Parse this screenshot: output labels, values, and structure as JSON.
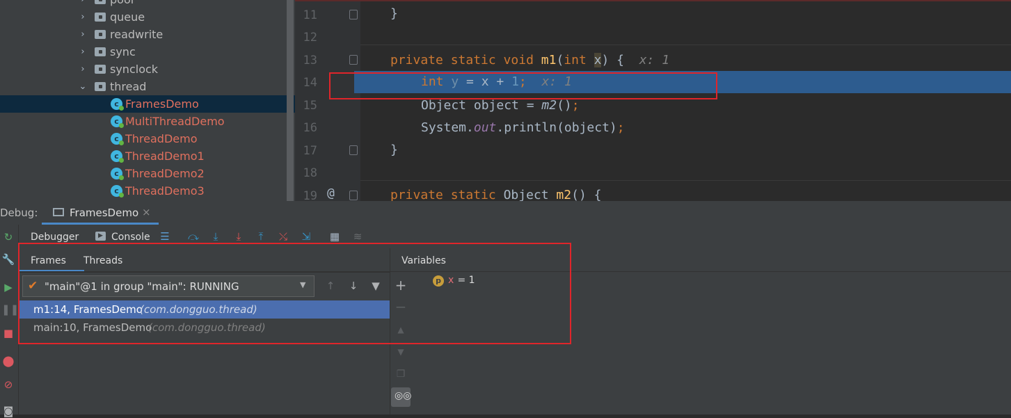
{
  "tree": {
    "items": [
      {
        "label": "pool",
        "type": "folder",
        "expanded": false
      },
      {
        "label": "queue",
        "type": "folder",
        "expanded": false
      },
      {
        "label": "readwrite",
        "type": "folder",
        "expanded": false
      },
      {
        "label": "sync",
        "type": "folder",
        "expanded": false
      },
      {
        "label": "synclock",
        "type": "folder",
        "expanded": false
      },
      {
        "label": "thread",
        "type": "folder",
        "expanded": true
      },
      {
        "label": "FramesDemo",
        "type": "class",
        "selected": true
      },
      {
        "label": "MultiThreadDemo",
        "type": "class"
      },
      {
        "label": "ThreadDemo",
        "type": "class"
      },
      {
        "label": "ThreadDemo1",
        "type": "class"
      },
      {
        "label": "ThreadDemo2",
        "type": "class"
      },
      {
        "label": "ThreadDemo3",
        "type": "class"
      }
    ]
  },
  "editor": {
    "line_numbers": [
      "11",
      "12",
      "13",
      "14",
      "15",
      "16",
      "17",
      "18",
      "19"
    ],
    "line11": "}",
    "line13": {
      "kw": "private static void ",
      "fn": "m1",
      "open": "(",
      "type": "int ",
      "param": "x",
      "close": ") {",
      "hint": "x: 1"
    },
    "line14": {
      "kw": "int ",
      "var": "y",
      "rest": " = x + ",
      "num": "1",
      "semi": ";",
      "hint": "x: 1"
    },
    "line15": {
      "pre": "Object object = ",
      "call": "m2",
      "post": "()",
      "semi": ";"
    },
    "line16": {
      "pre": "System.",
      "field": "out",
      "post": ".println(object)",
      "semi": ";"
    },
    "line17": "}",
    "line19": {
      "kw": "private static ",
      "type": "Object ",
      "fn": "m2",
      "rest": "() {"
    },
    "annotation": "@"
  },
  "debug": {
    "label": "Debug:",
    "session_tab": "FramesDemo",
    "tabs": [
      "Debugger",
      "Console"
    ]
  },
  "frames": {
    "tabs": [
      "Frames",
      "Threads"
    ],
    "thread_selector": "\"main\"@1 in group \"main\": RUNNING",
    "rows": [
      {
        "method": "m1:14, FramesDemo",
        "package": "(com.dongguo.thread)",
        "selected": true
      },
      {
        "method": "main:10, FramesDemo",
        "package": "(com.dongguo.thread)",
        "selected": false
      }
    ]
  },
  "variables": {
    "title": "Variables",
    "items": [
      {
        "badge": "p",
        "name": "x",
        "value": " = 1"
      }
    ]
  },
  "colors": {
    "accent": "#2d5c8f",
    "highlight_box": "#e0252a",
    "class_label": "#e0705e",
    "selection": "#4b6eaf"
  }
}
